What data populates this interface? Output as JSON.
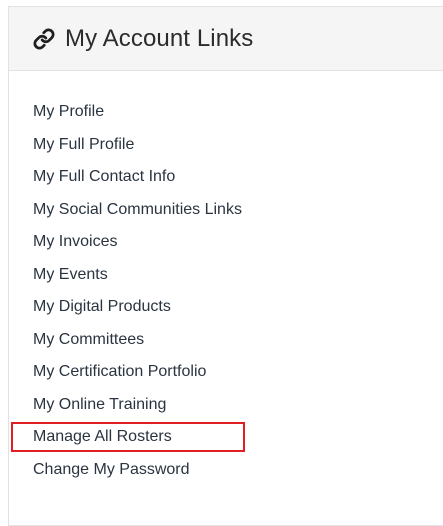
{
  "panel": {
    "title": "My Account Links",
    "title_icon": "link-icon",
    "links": [
      {
        "label": "My Profile"
      },
      {
        "label": "My Full Profile"
      },
      {
        "label": "My Full Contact Info"
      },
      {
        "label": "My Social Communities Links"
      },
      {
        "label": "My Invoices"
      },
      {
        "label": "My Events"
      },
      {
        "label": "My Digital Products"
      },
      {
        "label": "My Committees"
      },
      {
        "label": "My Certification Portfolio"
      },
      {
        "label": "My Online Training"
      },
      {
        "label": "Manage All Rosters",
        "highlighted": true
      },
      {
        "label": "Change My Password"
      }
    ]
  },
  "colors": {
    "highlight_border": "#e01e24",
    "link_text": "#2a3440",
    "header_bg": "#f5f5f5"
  }
}
